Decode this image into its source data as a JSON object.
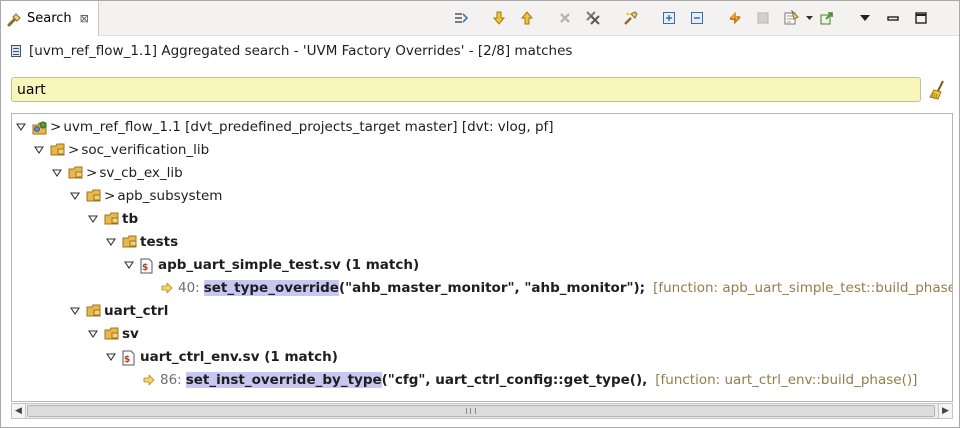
{
  "tab": {
    "label": "Search",
    "close_glyph": "⊠"
  },
  "header": {
    "text": "[uvm_ref_flow_1.1] Aggregated search - 'UVM Factory Overrides' - [2/8] matches"
  },
  "filter": {
    "value": "uart"
  },
  "toolbar": {
    "icons": [
      "run-search-icon",
      "next-match-icon",
      "previous-match-icon",
      "remove-match-icon",
      "remove-all-icon",
      "pin-icon",
      "expand-all-icon",
      "collapse-all-icon",
      "refresh-icon",
      "cancel-icon",
      "history-icon",
      "history-dropdown-icon",
      "export-icon",
      "view-menu-icon",
      "minimize-icon",
      "maximize-icon"
    ]
  },
  "tree": {
    "gt": ">",
    "project": "uvm_ref_flow_1.1 [dvt_predefined_projects_target master] [dvt: vlog, pf]",
    "lib1": "soc_verification_lib",
    "lib2": "sv_cb_ex_lib",
    "apb_subsystem": "apb_subsystem",
    "tb": "tb",
    "tests": "tests",
    "file1": "apb_uart_simple_test.sv (1 match)",
    "match1": {
      "line": "40:",
      "highlight": "set_type_override",
      "rest": "(\"ahb_master_monitor\", \"ahb_monitor\");",
      "context": "[function: apb_uart_simple_test::build_phase()]"
    },
    "uart_ctrl": "uart_ctrl",
    "sv": "sv",
    "file2": "uart_ctrl_env.sv (1 match)",
    "match2": {
      "line": "86:",
      "highlight": "set_inst_override_by_type",
      "rest": "(\"cfg\", uart_ctrl_config::get_type(),",
      "context": "[function: uart_ctrl_env::build_phase()]"
    }
  },
  "colors": {
    "filter_bg": "#f8f6bd",
    "match_highlight": "#c7c7f2",
    "context_text": "#977b4b",
    "folder": "#e8b84a"
  }
}
